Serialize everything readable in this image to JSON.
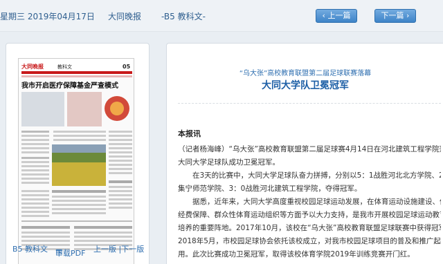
{
  "header": {
    "date": "星期三 2019年04月17日",
    "newspaper": "大同晚报",
    "page": "-B5 教科文-",
    "prev_label": "上一篇",
    "next_label": "下一篇"
  },
  "left_panel": {
    "thumbnail": {
      "masthead": "大同晚报",
      "section": "教科文",
      "page_no": "05",
      "headline": "我市开启医疗保障基金严查模式"
    },
    "page_label": "B5 教科文",
    "pdf_label": "下载PDF",
    "sibling_nav": "上一版 |下一版"
  },
  "article": {
    "subtitle": "“乌大张”高校教育联盟第二届足球联赛落幕",
    "title": "大同大学队卫冕冠军",
    "dateline": "本报讯",
    "lines": [
      "（记者杨海峰）“乌大张”高校教育联盟第二届足球赛4月14日在河北建筑工程学院落幕，",
      "大同大学足球队成功卫冕冠军。",
      "　　在3天的比赛中，大同大学足球队奋力拼搏，分别以5：1战胜河北北方学院、2：1战胜",
      "集宁师范学院、3：0战胜河北建筑工程学院，夺得冠军。",
      "　　据悉，近年来，大同大学高度重视校园足球运动发展，在体育运动设施建设、体育工作",
      "经费保障、群众性体育运动组织等方面予以大力支持，是我市开展校园足球运动教育和人才",
      "培养的重要阵地。2017年10月，该校在“乌大张”高校教育联盟足球联赛中获得冠军。",
      "2018年5月，市校园足球协会依托该校成立，对我市校园足球项目的普及和推广起到积极作",
      "用。此次比赛成功卫冕冠军，取得该校体育学院2019年训练竞赛开门红。"
    ]
  }
}
